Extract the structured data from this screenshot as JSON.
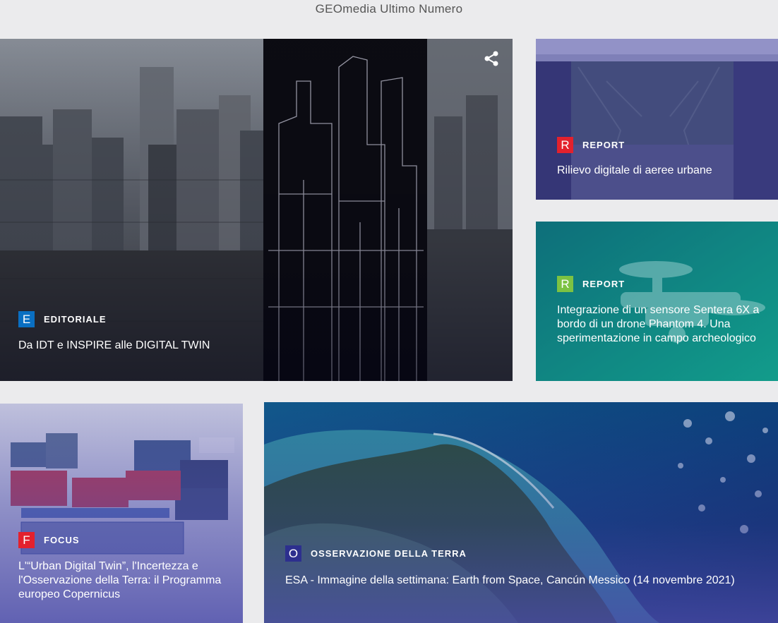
{
  "page": {
    "title": "GEOmedia Ultimo Numero"
  },
  "articles": [
    {
      "category": "EDITORIALE",
      "badge_letter": "E",
      "badge_color": "#0a6fc2",
      "title": "Da IDT e INSPIRE alle DIGITAL TWIN",
      "share_icon": "share-icon"
    },
    {
      "category": "REPORT",
      "badge_letter": "R",
      "badge_color": "#e3212d",
      "title": "Rilievo digitale di aeree urbane"
    },
    {
      "category": "REPORT",
      "badge_letter": "R",
      "badge_color": "#7cc242",
      "title": "Integrazione di un sensore Sentera 6X a bordo di un drone Phantom 4. Una sperimentazione in campo archeologico"
    },
    {
      "category": "FOCUS",
      "badge_letter": "F",
      "badge_color": "#e3212d",
      "title": "L'“Urban Digital Twin”, l'Incertezza e l'Osservazione della Terra: il Programma europeo Copernicus"
    },
    {
      "category": "OSSERVAZIONE DELLA TERRA",
      "badge_letter": "O",
      "badge_color": "#2d2f8e",
      "title": "ESA - Immagine della settimana: Earth from Space, Cancún Messico (14 novembre 2021)"
    }
  ],
  "colors": {
    "page_bg": "#ebebed",
    "overlay_purple": "#4a4aa8",
    "overlay_teal": "#0f8f8a"
  }
}
